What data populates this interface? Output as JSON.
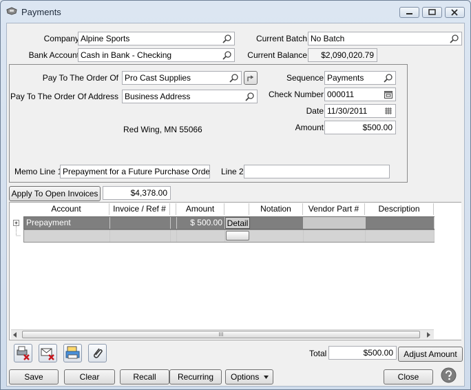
{
  "window": {
    "title": "Payments"
  },
  "header": {
    "company_label": "Company",
    "company_value": "Alpine Sports",
    "bank_label": "Bank Account",
    "bank_value": "Cash in Bank - Checking",
    "batch_label": "Current Batch",
    "batch_value": "No Batch",
    "balance_label": "Current Balance",
    "balance_value": "$2,090,020.79"
  },
  "check": {
    "pay_to_label": "Pay To The Order Of",
    "pay_to_value": "Pro Cast Supplies",
    "address_label": "Pay To The Order Of Address",
    "address_value": "Business Address",
    "address_line": "Red Wing, MN  55066",
    "sequence_label": "Sequence",
    "sequence_value": "Payments",
    "check_number_label": "Check Number",
    "check_number_value": "000011",
    "date_label": "Date",
    "date_value": "11/30/2011",
    "amount_label": "Amount",
    "amount_value": "$500.00",
    "memo1_label": "Memo Line 1",
    "memo1_value": "Prepayment for a Future Purchase Order",
    "memo2_label": "Line 2",
    "memo2_value": ""
  },
  "apply": {
    "button_label": "Apply To Open Invoices",
    "value": "$4,378.00"
  },
  "grid": {
    "columns": [
      "Account",
      "Invoice / Ref #",
      "Amount",
      "",
      "Notation",
      "Vendor Part #",
      "Description"
    ],
    "rows": [
      {
        "account": "Prepayment",
        "invoice": "",
        "amount": "$ 500.00",
        "detail": "Detail",
        "notation": "",
        "vendor_part": "",
        "description": ""
      },
      {
        "account": "",
        "invoice": "",
        "amount": "",
        "detail": "",
        "notation": "",
        "vendor_part": "",
        "description": ""
      }
    ],
    "scroll_grip": "III"
  },
  "totals": {
    "total_label": "Total",
    "total_value": "$500.00",
    "adjust_label": "Adjust Amount"
  },
  "buttons": {
    "save": "Save",
    "clear": "Clear",
    "recall": "Recall",
    "recurring": "Recurring",
    "options": "Options",
    "close": "Close"
  }
}
